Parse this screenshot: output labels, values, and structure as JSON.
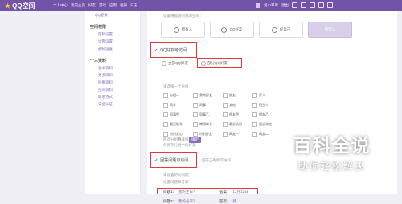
{
  "topbar": {
    "logo": "QQ空间",
    "nav": [
      "个人中心",
      "我的主页",
      "好友",
      "游戏",
      "应用",
      "相册",
      "日志"
    ],
    "user": "爱小翠翠",
    "user_tag": "退出"
  },
  "sidebar": {
    "top_item": "QQ登录",
    "group1": "空间权限",
    "group1_items": [
      "隐私设置",
      "访客设置",
      "通知设置"
    ],
    "group2": "个人资料",
    "group2_items": [
      "基本资料",
      "更多资料",
      "形象资料",
      "空间资料",
      "联系方式",
      "安全认证"
    ]
  },
  "main": {
    "hint": "设置谁能访问我的空间：",
    "tabs": [
      "所有人",
      "QQ好友",
      "仅自己",
      "指定人"
    ],
    "section1": "QQ好友可访问",
    "options1": [
      "全部QQ好友",
      "部分QQ好友"
    ],
    "sub1": "请选择一个分组",
    "grid": [
      "分组一",
      "我的好友",
      "朋友",
      "家人",
      "同学",
      "同事",
      "其他",
      "陌生人",
      "同事甲",
      "同事乙",
      "朋友甲",
      "朋友乙",
      "最近联系",
      "常用联系",
      "最近访问",
      "最近浏览",
      "特别关心",
      "特别好友",
      "网友一",
      "网友二"
    ],
    "sub2": "所选分组数",
    "sub2_value": "0",
    "sub2_note": "仅保存分组中的好友",
    "sub3": "已选择",
    "button_label": "确定",
    "section2": "回答问题可访问",
    "section2_note": "回答正确即可访问",
    "sub4": "请设置访问问题：",
    "sub5": "设置问题和答案",
    "q1_label": "问题1：",
    "q1_value": "我的生日？",
    "a1_label": "答案：",
    "a1_value": "12月12日",
    "q2_label": "问题2：",
    "q2_value": "我的名字？",
    "a2_label": "答案：",
    "a2_value": "韩"
  },
  "watermark": {
    "main": "百科全说",
    "sub": "助你轻松解决"
  }
}
